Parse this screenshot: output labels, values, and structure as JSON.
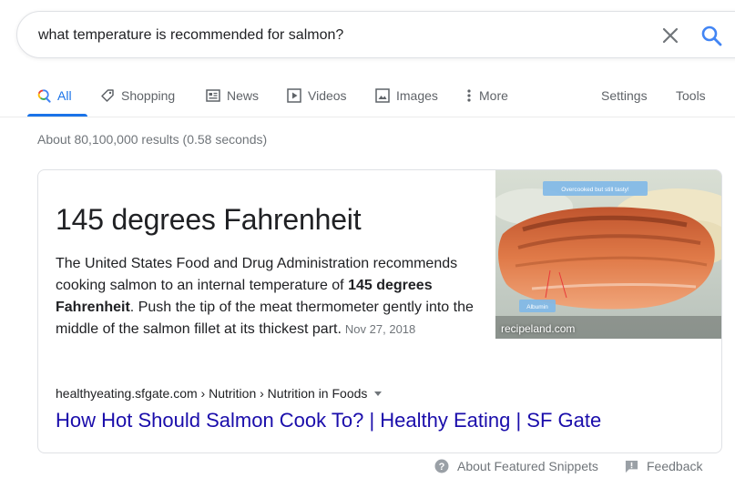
{
  "search": {
    "query": "what temperature is recommended for salmon?",
    "clear_icon": "close-icon",
    "search_icon": "search-icon"
  },
  "tabs": [
    {
      "label": "All",
      "icon": "search-icon",
      "active": true
    },
    {
      "label": "Shopping",
      "icon": "tag-icon"
    },
    {
      "label": "News",
      "icon": "news-icon"
    },
    {
      "label": "Videos",
      "icon": "play-icon"
    },
    {
      "label": "Images",
      "icon": "image-icon"
    },
    {
      "label": "More",
      "icon": "more-vert-icon"
    }
  ],
  "tools": {
    "settings_label": "Settings",
    "tools_label": "Tools"
  },
  "result_stats": "About 80,100,000 results (0.58 seconds)",
  "snippet": {
    "answer": "145 degrees Fahrenheit",
    "text_before": "The United States Food and Drug Administration recommends cooking salmon to an internal temperature of ",
    "text_bold": "145 degrees Fahrenheit",
    "text_after": ". Push the tip of the meat thermometer gently into the middle of the salmon fillet at its thickest part.",
    "date": "Nov 27, 2018",
    "image": {
      "caption": "recipeland.com",
      "label_top": "Overcooked but still tasty!",
      "label_bottom": "Albumin"
    },
    "cite": "healthyeating.sfgate.com › Nutrition › Nutrition in Foods",
    "link_title": "How Hot Should Salmon Cook To? | Healthy Eating | SF Gate"
  },
  "footer": {
    "about_label": "About Featured Snippets",
    "feedback_label": "Feedback"
  },
  "colors": {
    "accent": "#1a73e8",
    "link": "#1a0dab",
    "muted": "#70757a"
  }
}
